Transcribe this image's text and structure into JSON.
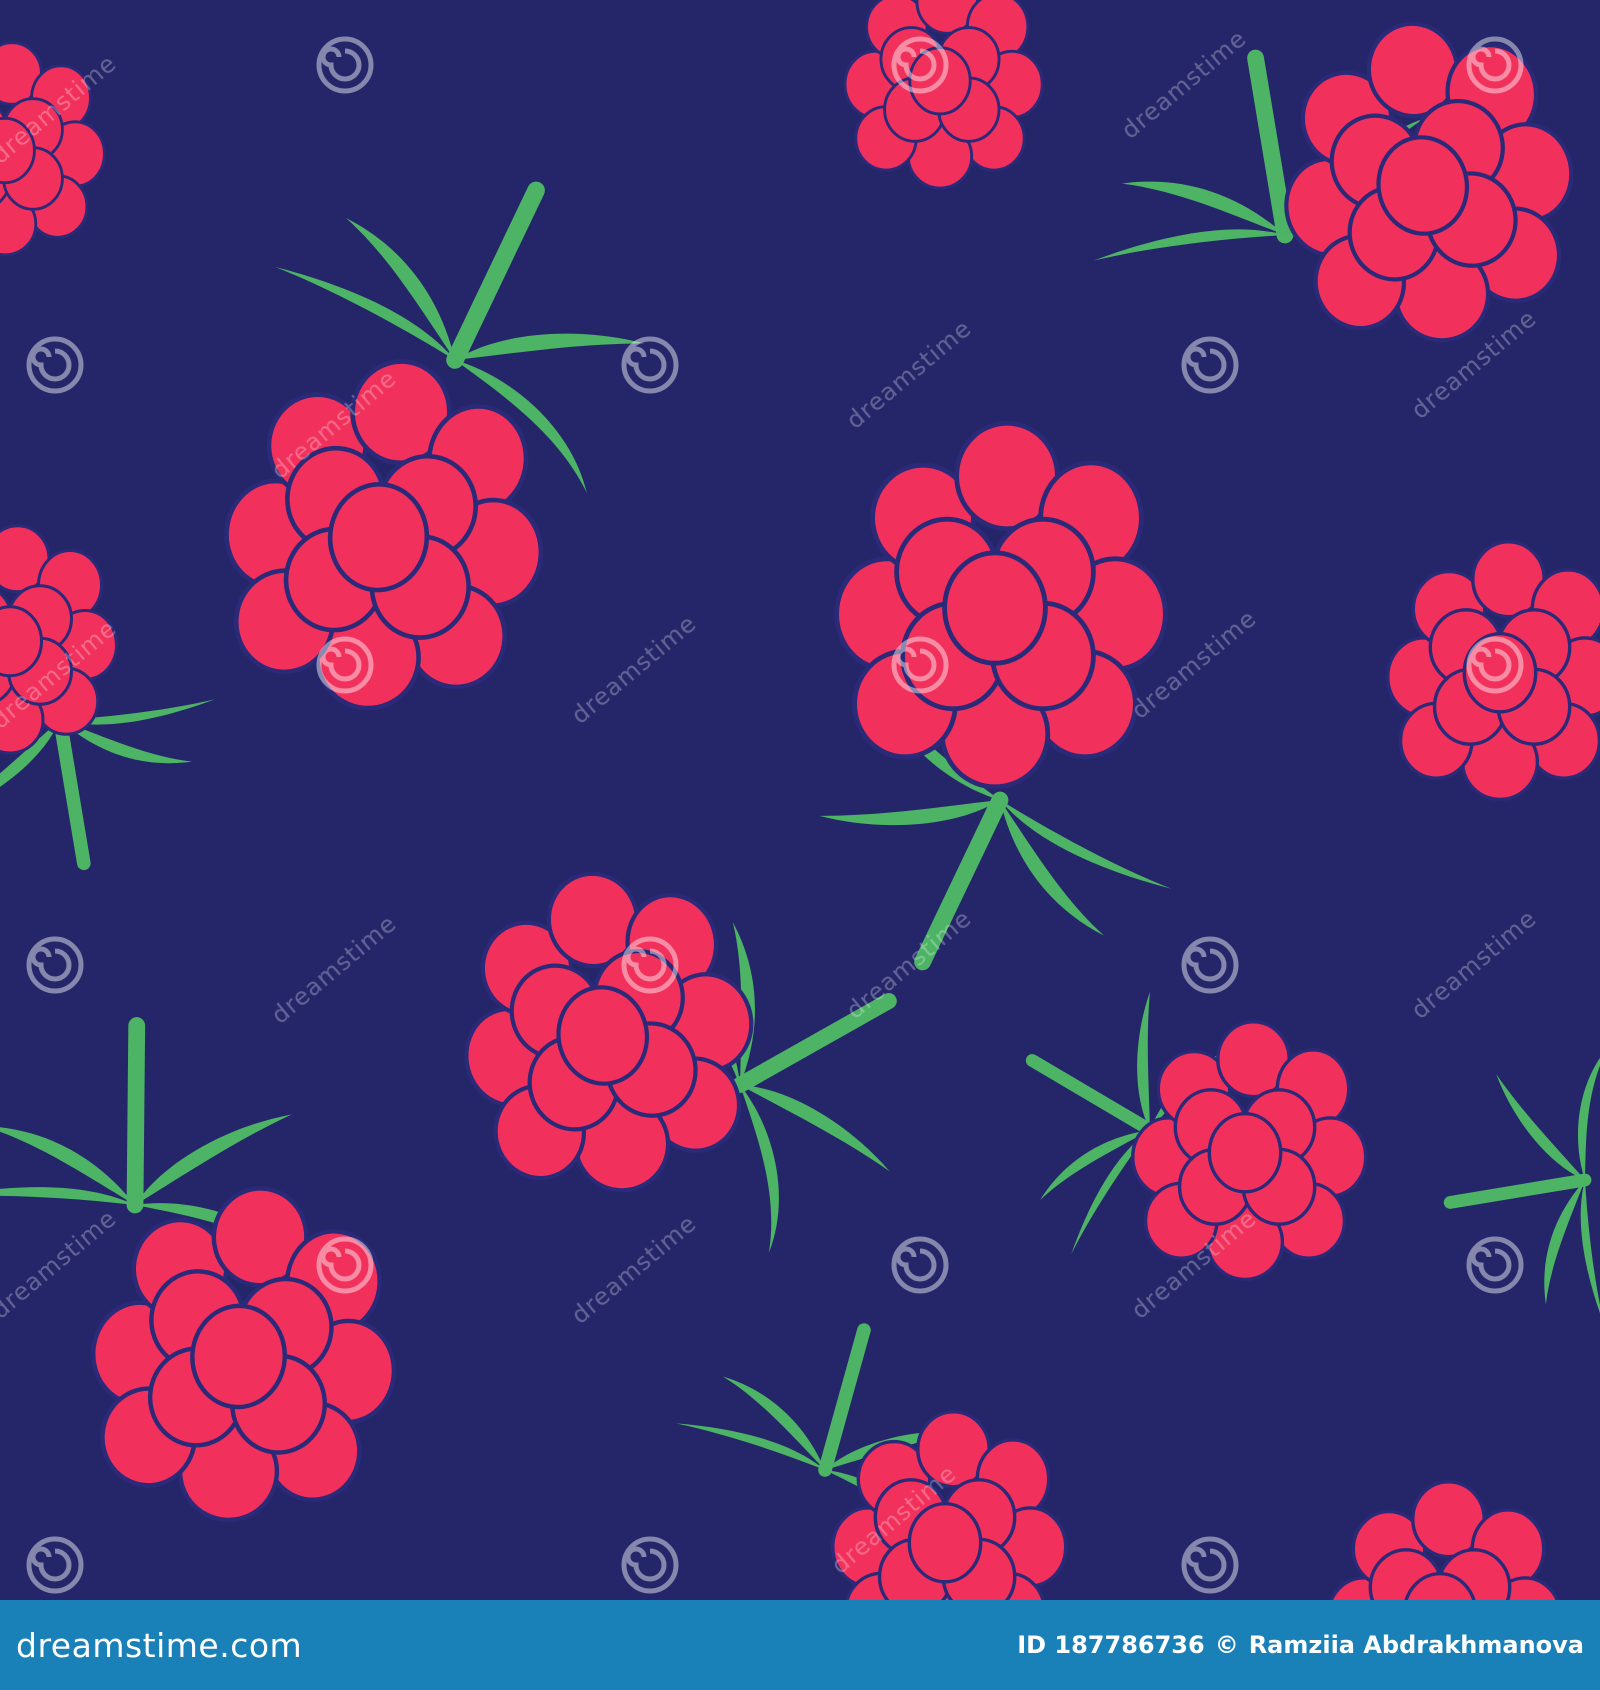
{
  "colors": {
    "background": "#25266a",
    "berry": "#f2305c",
    "berry_outline": "#2a2a78",
    "leaf": "#4db365",
    "footer": "#1a80b8"
  },
  "watermark": {
    "text": "dreamstime",
    "icon": "spiral-icon"
  },
  "footer": {
    "brand_prefix": "dreamstime",
    "brand_suffix": ".com",
    "image_id": "ID 187786736",
    "copyright_symbol": "©",
    "author": "Ramziia Abdrakhmanova"
  }
}
